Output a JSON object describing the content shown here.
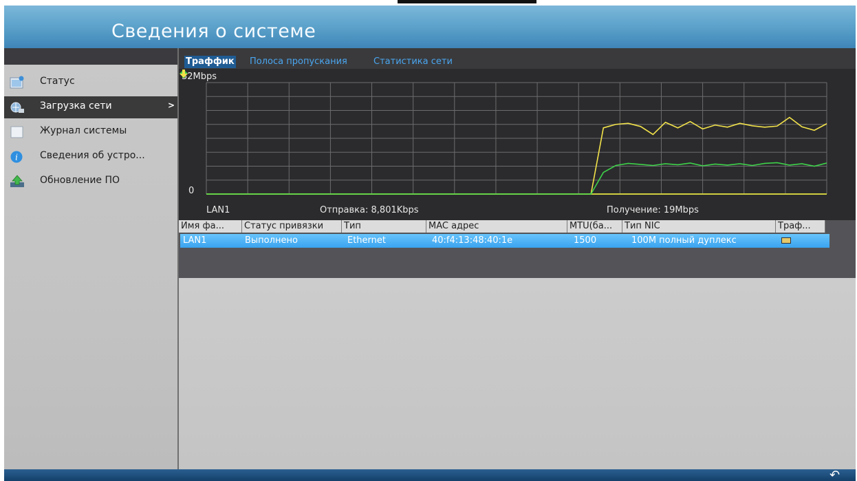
{
  "window": {
    "title": "Сведения о системе"
  },
  "sidebar": {
    "items": [
      {
        "label": "Статус",
        "icon": "status-icon"
      },
      {
        "label": "Загрузка сети",
        "icon": "network-load-icon",
        "arrow": ">"
      },
      {
        "label": "Журнал системы",
        "icon": "log-icon"
      },
      {
        "label": "Сведения об устро...",
        "icon": "info-icon"
      },
      {
        "label": "Обновление ПО",
        "icon": "upgrade-icon"
      }
    ]
  },
  "tabs": [
    {
      "label": "Траффик",
      "active": true
    },
    {
      "label": "Полоса пропускания",
      "active": false
    },
    {
      "label": "Статистика сети",
      "active": false
    }
  ],
  "graph": {
    "scale_max": "32Mbps",
    "scale_min": "0",
    "interface": "LAN1",
    "send": "Отправка: 8,801Kbps",
    "receive": "Получение: 19Mbps"
  },
  "chart_data": {
    "type": "line",
    "ylim": [
      0,
      32
    ],
    "x": [
      0,
      1,
      2,
      3,
      4,
      5,
      6,
      7,
      8,
      9,
      10,
      11,
      12,
      13,
      14,
      15,
      16,
      17,
      18,
      19,
      20,
      21,
      22,
      23,
      24,
      25,
      26,
      27,
      28,
      29,
      30,
      31,
      32,
      33,
      34,
      35,
      36,
      37,
      38,
      39,
      40,
      41,
      42,
      43,
      44,
      45,
      46,
      47,
      48,
      49,
      50
    ],
    "series": [
      {
        "values": [
          0,
          0,
          0,
          0,
          0,
          0,
          0,
          0,
          0,
          0,
          0,
          0,
          0,
          0,
          0,
          0,
          0,
          0,
          0,
          0,
          0,
          0,
          0,
          0,
          0,
          0,
          0,
          0,
          0,
          0,
          0,
          0,
          19,
          20,
          20.3,
          19.4,
          17.1,
          20.6,
          19,
          20.8,
          18.7,
          19.8,
          19.2,
          20.3,
          19.6,
          19.2,
          19.5,
          22,
          19.3,
          18.3,
          20.2
        ],
        "color": "#f2e24a"
      },
      {
        "values": [
          0,
          0,
          0,
          0,
          0,
          0,
          0,
          0,
          0,
          0,
          0,
          0,
          0,
          0,
          0,
          0,
          0,
          0,
          0,
          0,
          0,
          0,
          0,
          0,
          0,
          0,
          0,
          0,
          0,
          0,
          0,
          0,
          6.2,
          8.2,
          8.8,
          8.5,
          8.2,
          8.7,
          8.4,
          8.9,
          8.1,
          8.6,
          8.3,
          8.7,
          8.2,
          8.8,
          9,
          8.3,
          8.7,
          8,
          8.9
        ],
        "color": "#3ed24a"
      }
    ]
  },
  "table": {
    "columns": [
      "Имя фа...",
      "Статус привязки",
      "Тип",
      "MAC адрес",
      "MTU(ба...",
      "Тип NIC",
      "Траф..."
    ],
    "rows": [
      {
        "name": "LAN1",
        "status": "Выполнено",
        "type": "Ethernet",
        "mac": "40:f4:13:48:40:1e",
        "mtu": "1500",
        "nic": "100M полный дуплекс",
        "traffic_icon": "chart-icon"
      }
    ]
  },
  "footer": {
    "back_icon": "back-arrow-icon"
  },
  "colors": {
    "header": "#5ea4cc",
    "tab_active": "#1f5c94",
    "row_selected": "#3aa3ef",
    "send_line": "#f2e24a",
    "receive_line": "#3ed24a"
  }
}
